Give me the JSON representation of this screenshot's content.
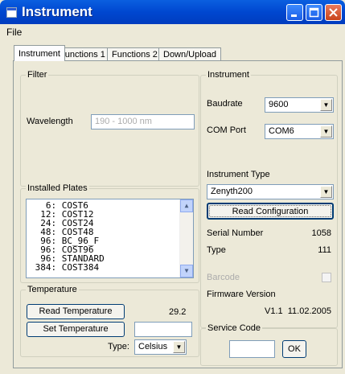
{
  "window": {
    "title": "Instrument"
  },
  "menu": {
    "file": "File"
  },
  "tabs": [
    "Instrument",
    "Functions 1",
    "Functions 2",
    "Down/Upload"
  ],
  "filter": {
    "group_label": "Filter",
    "wavelength_label": "Wavelength",
    "wavelength_value": "190 - 1000 nm"
  },
  "plates": {
    "group_label": "Installed Plates",
    "items": [
      "   6: COST6",
      "  12: COST12",
      "  24: COST24",
      "  48: COST48",
      "  96: BC_96_F",
      "  96: COST96",
      "  96: STANDARD",
      " 384: COST384"
    ]
  },
  "temperature": {
    "group_label": "Temperature",
    "read_button": "Read Temperature",
    "value": "29.2",
    "set_button": "Set Temperature",
    "set_value": "",
    "type_label": "Type:",
    "type_value": "Celsius"
  },
  "instrument": {
    "group_label": "Instrument",
    "baudrate_label": "Baudrate",
    "baudrate_value": "9600",
    "comport_label": "COM Port",
    "comport_value": "COM6",
    "type_group_label": "Instrument Type",
    "type_value": "Zenyth200",
    "read_config_button": "Read Configuration",
    "serial_label": "Serial Number",
    "serial_value": "1058",
    "type_label": "Type",
    "type_number": "111",
    "barcode_label": "Barcode",
    "firmware_label": "Firmware Version",
    "firmware_value": "V1.1  11.02.2005"
  },
  "service": {
    "group_label": "Service Code",
    "code_value": "",
    "ok_button": "OK"
  }
}
